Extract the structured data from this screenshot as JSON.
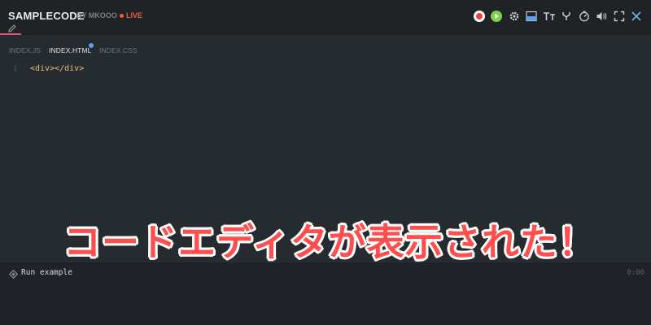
{
  "header": {
    "title": "SAMPLECODE",
    "byline": "BY MKOOO",
    "live_label": "LIVE",
    "live_color": "#e8603c",
    "toolbar": [
      {
        "name": "record-icon"
      },
      {
        "name": "play-icon"
      },
      {
        "name": "gear-icon"
      },
      {
        "name": "layout-icon"
      },
      {
        "name": "font-size-icon"
      },
      {
        "name": "fork-icon"
      },
      {
        "name": "timer-icon"
      },
      {
        "name": "volume-icon"
      },
      {
        "name": "fullscreen-icon"
      },
      {
        "name": "close-icon"
      }
    ]
  },
  "tabs": [
    {
      "label": "INDEX.JS",
      "active": false
    },
    {
      "label": "INDEX.HTML",
      "active": true,
      "modified": true
    },
    {
      "label": "INDEX.CSS",
      "active": false
    }
  ],
  "editor": {
    "lines": [
      {
        "number": "1",
        "code": "<div></div>"
      }
    ]
  },
  "runbar": {
    "label": "Run example",
    "time": "0:00"
  },
  "overlay": {
    "caption": "コードエディタが表示された！",
    "color": "#ff4e4e"
  }
}
